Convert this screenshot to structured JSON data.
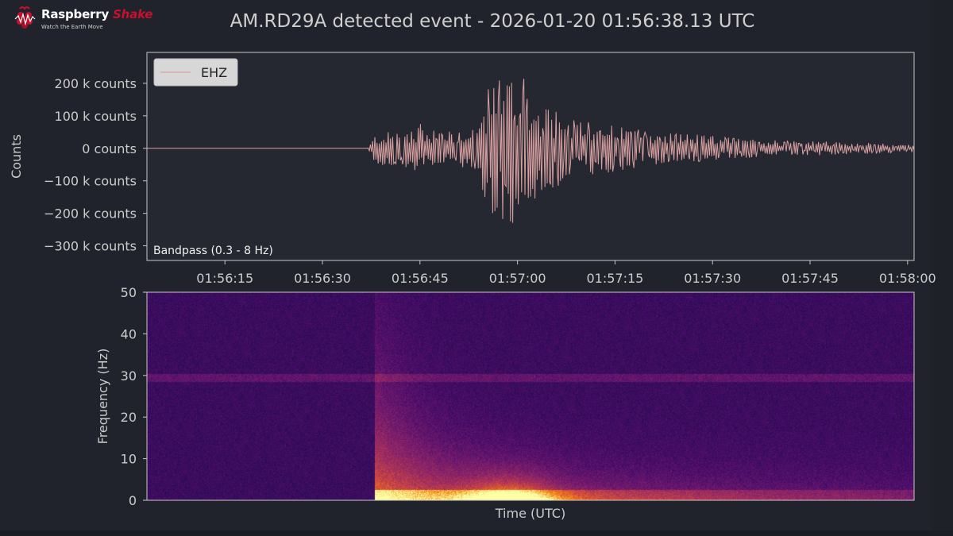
{
  "header": {
    "logo_name": "Raspberry",
    "logo_name_accent": "Shake",
    "logo_tagline": "Watch the Earth Move",
    "title": "AM.RD29A detected event - 2026-01-20 01:56:38.13 UTC"
  },
  "chart_data": [
    {
      "type": "line",
      "ylabel": "Counts",
      "legend": {
        "labels": [
          "EHZ"
        ],
        "placement": "top-left"
      },
      "annotation": "Bandpass (0.3 - 8 Hz)",
      "x_range": [
        "01:56:03",
        "01:58:01"
      ],
      "x_ticks": [
        "01:56:15",
        "01:56:30",
        "01:56:45",
        "01:57:00",
        "01:57:15",
        "01:57:30",
        "01:57:45",
        "01:58:00"
      ],
      "y_ticks": [
        "200 k counts",
        "100 k counts",
        "0  counts",
        "−100 k counts",
        "−200 k counts",
        "−300 k counts"
      ],
      "ylim": [
        -345000,
        295000
      ],
      "series": [
        {
          "name": "EHZ",
          "color": "#d9a0a0",
          "envelope": [
            {
              "t": "01:56:03",
              "max": 0,
              "min": 0
            },
            {
              "t": "01:56:37",
              "max": 0,
              "min": 0
            },
            {
              "t": "01:56:38",
              "max": 40000,
              "min": -50000
            },
            {
              "t": "01:56:45",
              "max": 75000,
              "min": -75000
            },
            {
              "t": "01:56:50",
              "max": 50000,
              "min": -50000
            },
            {
              "t": "01:56:54",
              "max": 80000,
              "min": -80000
            },
            {
              "t": "01:56:56",
              "max": 220000,
              "min": -250000
            },
            {
              "t": "01:56:59",
              "max": 230000,
              "min": -290000
            },
            {
              "t": "01:57:01",
              "max": 250000,
              "min": -200000
            },
            {
              "t": "01:57:03",
              "max": 130000,
              "min": -150000
            },
            {
              "t": "01:57:10",
              "max": 90000,
              "min": -90000
            },
            {
              "t": "01:57:20",
              "max": 55000,
              "min": -55000
            },
            {
              "t": "01:57:35",
              "max": 30000,
              "min": -30000
            },
            {
              "t": "01:58:00",
              "max": 12000,
              "min": -12000
            }
          ]
        }
      ]
    },
    {
      "type": "heatmap",
      "xlabel": "Time (UTC)",
      "ylabel": "Frequency (Hz)",
      "x_range": [
        "01:56:03",
        "01:58:01"
      ],
      "ylim": [
        0,
        50
      ],
      "y_ticks": [
        0,
        10,
        20,
        30,
        40,
        50
      ],
      "colormap": "inferno",
      "features": [
        {
          "kind": "constant line",
          "frequency_hz": 29.5
        },
        {
          "kind": "event onset",
          "t": "01:56:38",
          "max_frequency_hz": 24
        },
        {
          "kind": "peak energy",
          "t": "01:56:59",
          "frequency_range_hz": [
            0,
            8
          ]
        }
      ]
    }
  ]
}
